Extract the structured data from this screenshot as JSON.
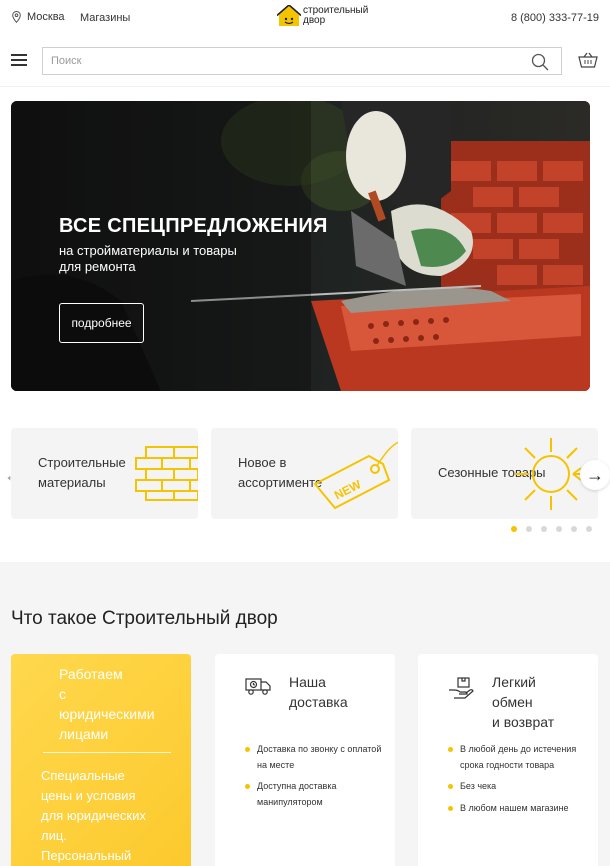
{
  "header": {
    "city": "Москва",
    "stores": "Магазины",
    "logo_line1": "строительный",
    "logo_line2": "двор",
    "phone": "8 (800) 333-77-19"
  },
  "search": {
    "placeholder": "Поиск"
  },
  "hero": {
    "title": "ВСЕ СПЕЦПРЕДЛОЖЕНИЯ",
    "subtitle_line1": "на стройматериалы и товары",
    "subtitle_line2": "для ремонта",
    "button": "подробнее"
  },
  "categories": {
    "items": [
      {
        "line1": "Строительные",
        "line2": "материалы",
        "icon": "bricks-icon"
      },
      {
        "line1": "Новое в",
        "line2": "ассортименте",
        "icon": "new-tag-icon",
        "tag_text": "NEW"
      },
      {
        "line1": "Сезонные товары",
        "icon": "sun-snowflake-icon"
      }
    ],
    "prev_arrow": "←",
    "next_arrow": "→",
    "dots_total": 6,
    "dots_active": 1
  },
  "about": {
    "title": "Что такое Строительный двор",
    "legal": {
      "title_lines": [
        "Работаем",
        "с",
        "юридическими",
        "лицами"
      ],
      "text_lines": [
        "Специальные",
        "цены и условия",
        "для юридических",
        "лиц.",
        "Персональный"
      ]
    },
    "delivery": {
      "title_lines": [
        "Наша",
        "доставка"
      ],
      "icon": "delivery-truck-icon",
      "bullets": [
        "Доставка по звонку с оплатой на месте",
        "Доступна доставка манипулятором"
      ]
    },
    "exchange": {
      "title_lines": [
        "Легкий",
        "обмен",
        "и возврат"
      ],
      "icon": "return-box-icon",
      "bullets": [
        "В любой день до истечения срока годности товара",
        "Без чека",
        "В любом нашем магазине"
      ]
    }
  },
  "colors": {
    "accent": "#f5c400",
    "card_yellow": "#fcc92c",
    "section_bg": "#f5f5f5"
  }
}
